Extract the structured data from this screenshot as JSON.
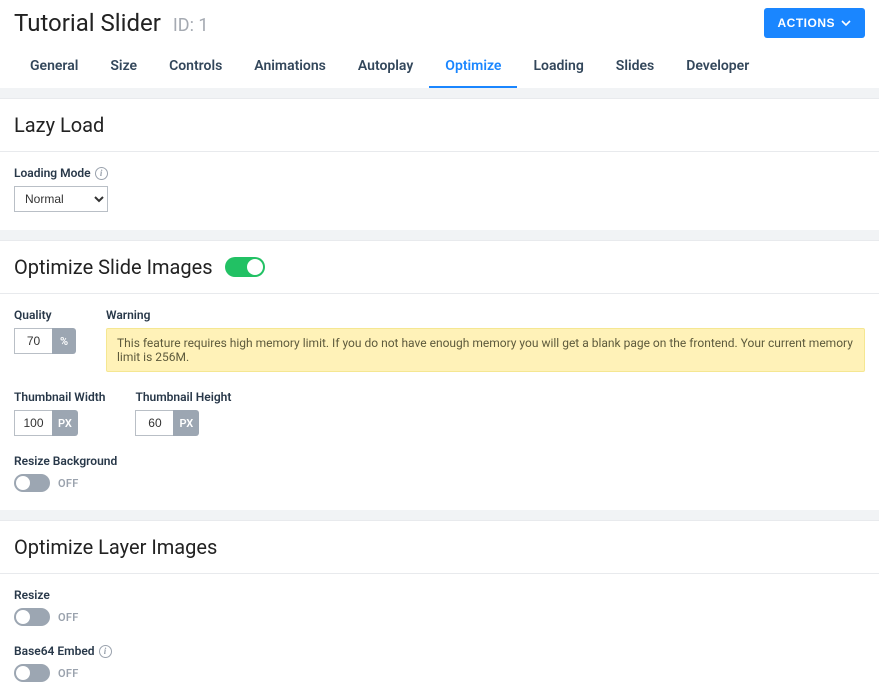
{
  "header": {
    "title": "Tutorial Slider",
    "id_label": "ID: 1",
    "actions_label": "ACTIONS"
  },
  "tabs": [
    {
      "label": "General",
      "key": "general"
    },
    {
      "label": "Size",
      "key": "size"
    },
    {
      "label": "Controls",
      "key": "controls"
    },
    {
      "label": "Animations",
      "key": "animations"
    },
    {
      "label": "Autoplay",
      "key": "autoplay"
    },
    {
      "label": "Optimize",
      "key": "optimize",
      "active": true
    },
    {
      "label": "Loading",
      "key": "loading"
    },
    {
      "label": "Slides",
      "key": "slides"
    },
    {
      "label": "Developer",
      "key": "developer"
    }
  ],
  "lazy": {
    "title": "Lazy Load",
    "loading_mode_label": "Loading Mode",
    "loading_mode_value": "Normal"
  },
  "slideImages": {
    "title": "Optimize Slide Images",
    "enabled": true,
    "quality_label": "Quality",
    "quality_value": "70",
    "quality_unit": "%",
    "warning_label": "Warning",
    "warning_text": "This feature requires high memory limit. If you do not have enough memory you will get a blank page on the frontend. Your current memory limit is 256M.",
    "thumb_w_label": "Thumbnail Width",
    "thumb_w_value": "100",
    "thumb_h_label": "Thumbnail Height",
    "thumb_h_value": "60",
    "px_unit": "PX",
    "resize_bg_label": "Resize Background",
    "resize_bg_state": "OFF"
  },
  "layerImages": {
    "title": "Optimize Layer Images",
    "resize_label": "Resize",
    "resize_state": "OFF",
    "base64_label": "Base64 Embed",
    "base64_state": "OFF"
  }
}
